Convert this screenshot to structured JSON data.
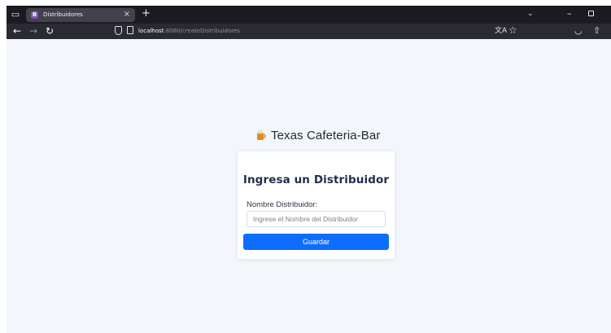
{
  "browser": {
    "tab_title": "Distribuidores",
    "tab_favicon": "B",
    "tab_close": "×",
    "new_tab": "+",
    "url_host": "localhost",
    "url_rest": ":8080/createDistribuidores"
  },
  "icons": {
    "window_menu": "window-menu-icon",
    "favicon": "bootstrap-icon",
    "back": "back-arrow-icon",
    "forward": "forward-arrow-icon",
    "reload": "reload-icon",
    "shield": "tracking-protection-shield-icon",
    "page": "page-info-icon",
    "translate": "translate-icon",
    "bookmark": "bookmark-star-icon",
    "pocket": "pocket-icon",
    "extensions": "extensions-icon",
    "tab_list": "chevron-down-icon",
    "minimize": "minimize-icon",
    "maximize": "maximize-icon",
    "brand_logo": "coffee-cup-icon"
  },
  "header": {
    "brand_name": "Texas Cafeteria-Bar"
  },
  "form": {
    "title": "Ingresa un Distribuidor",
    "label": "Nombre Distribuidor:",
    "input_value": "",
    "placeholder": "Ingrese el Nombre del Distribuidor",
    "submit_label": "Guardar"
  },
  "colors": {
    "page_background": "#f3f6fb",
    "primary_button": "#0d6efd",
    "title_text": "#1e2f49",
    "browser_chrome": "#1c1b22"
  }
}
